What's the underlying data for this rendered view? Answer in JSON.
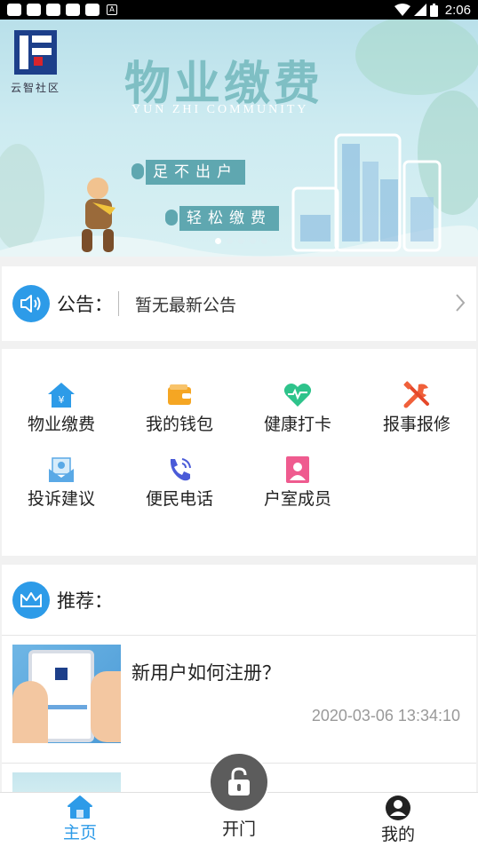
{
  "status_bar": {
    "time": "2:06"
  },
  "banner": {
    "title": "物业缴费",
    "subtitle": "YUN ZHI COMMUNITY",
    "logo_text": "云智社区",
    "slogan1": "足不出户",
    "slogan2": "轻松缴费",
    "dots": 5,
    "active_dot": 1
  },
  "notice": {
    "label": "公告：",
    "text": "暂无最新公告"
  },
  "services": [
    {
      "label": "物业缴费",
      "icon": "house-yen-icon",
      "color": "#2d9be8"
    },
    {
      "label": "我的钱包",
      "icon": "wallet-icon",
      "color": "#f5a623"
    },
    {
      "label": "健康打卡",
      "icon": "heart-pulse-icon",
      "color": "#2ec38b"
    },
    {
      "label": "报事报修",
      "icon": "tools-icon",
      "color": "#f0603a"
    },
    {
      "label": "投诉建议",
      "icon": "complaint-icon",
      "color": "#5aa9e6"
    },
    {
      "label": "便民电话",
      "icon": "phone-icon",
      "color": "#4a5bd8"
    },
    {
      "label": "户室成员",
      "icon": "member-icon",
      "color": "#ef5b8f"
    }
  ],
  "recommend": {
    "label": "推荐：",
    "articles": [
      {
        "title": "新用户如何注册？",
        "time": "2020-03-06 13:34:10"
      }
    ]
  },
  "tabbar": {
    "home": "主页",
    "door": "开门",
    "me": "我的",
    "active_color": "#2d9be8"
  }
}
